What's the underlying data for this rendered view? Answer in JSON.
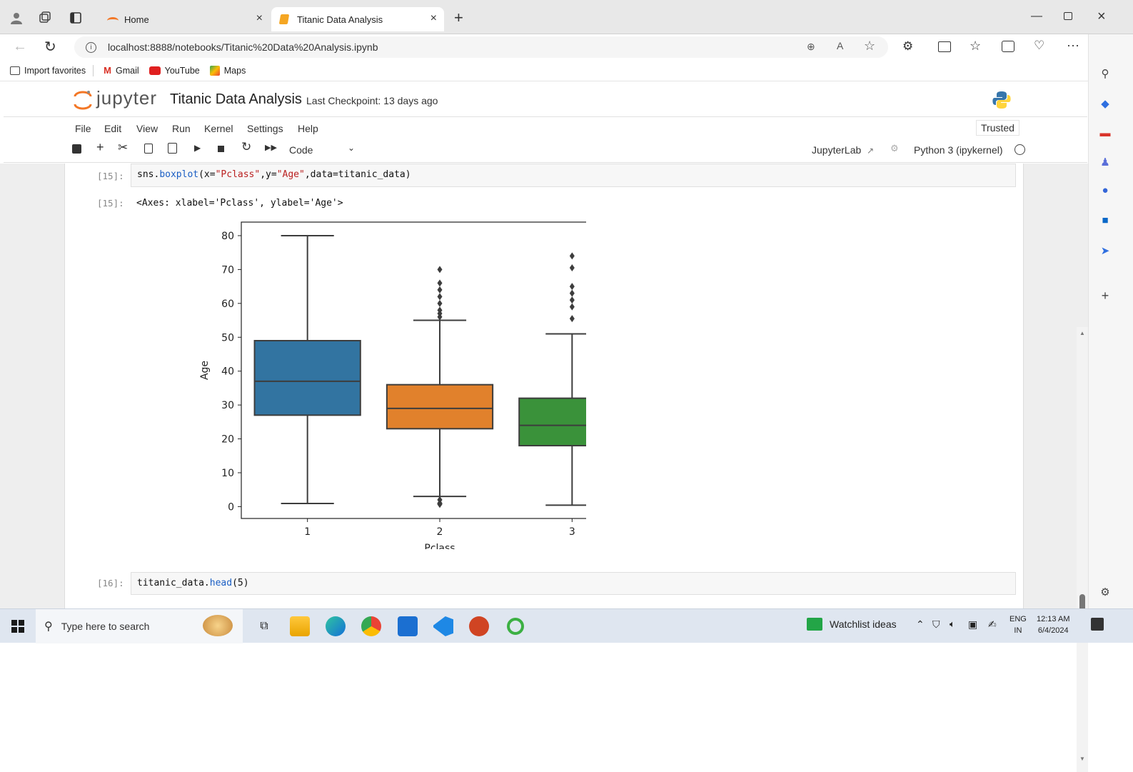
{
  "browser": {
    "tabs": [
      {
        "title": "Home"
      },
      {
        "title": "Titanic Data Analysis"
      }
    ],
    "url": "localhost:8888/notebooks/Titanic%20Data%20Analysis.ipynb",
    "favorites": [
      "Import favorites",
      "Gmail",
      "YouTube",
      "Maps"
    ]
  },
  "jupyter": {
    "logo_text": "jupyter",
    "notebook_title": "Titanic Data Analysis",
    "checkpoint": "Last Checkpoint: 13 days ago",
    "trusted": "Trusted",
    "menu": [
      "File",
      "Edit",
      "View",
      "Run",
      "Kernel",
      "Settings",
      "Help"
    ],
    "cell_type": "Code",
    "jupyterlab_label": "JupyterLab",
    "kernel_label": "Python 3 (ipykernel)"
  },
  "cells": {
    "c15_prompt_in": "[15]:",
    "c15_code_a": "sns.",
    "c15_code_b": "boxplot",
    "c15_code_c": "(x=",
    "c15_code_d": "\"Pclass\"",
    "c15_code_e": ",y=",
    "c15_code_f": "\"Age\"",
    "c15_code_g": ",data=titanic_data)",
    "c15_prompt_out": "[15]:",
    "c15_output": "<Axes: xlabel='Pclass', ylabel='Age'>",
    "c16_prompt_in": "[16]:",
    "c16_code_a": "titanic_data.",
    "c16_code_b": "head",
    "c16_code_c": "(5)"
  },
  "chart_data": {
    "type": "box",
    "xlabel": "Pclass",
    "ylabel": "Age",
    "ylim": [
      -3.5,
      84
    ],
    "yticks": [
      0,
      10,
      20,
      30,
      40,
      50,
      60,
      70,
      80
    ],
    "categories": [
      "1",
      "2",
      "3"
    ],
    "colors": [
      "#3274a1",
      "#e1812c",
      "#3a923a"
    ],
    "boxes": [
      {
        "q1": 27,
        "median": 37,
        "q3": 49,
        "whisker_low": 0.92,
        "whisker_high": 80,
        "outliers": []
      },
      {
        "q1": 23,
        "median": 29,
        "q3": 36,
        "whisker_low": 3,
        "whisker_high": 55,
        "outliers": [
          0.67,
          0.83,
          0.83,
          1,
          1,
          1,
          2,
          2,
          56,
          57,
          58,
          60,
          62,
          64,
          66,
          70
        ]
      },
      {
        "q1": 18,
        "median": 24,
        "q3": 32,
        "whisker_low": 0.42,
        "whisker_high": 51,
        "outliers": [
          55.5,
          59,
          61,
          63,
          65,
          70.5,
          74
        ]
      }
    ],
    "grid": false
  },
  "taskbar": {
    "search_placeholder": "Type here to search",
    "watchlist": "Watchlist ideas",
    "lang1": "ENG",
    "lang2": "IN",
    "time": "12:13 AM",
    "date": "6/4/2024"
  }
}
